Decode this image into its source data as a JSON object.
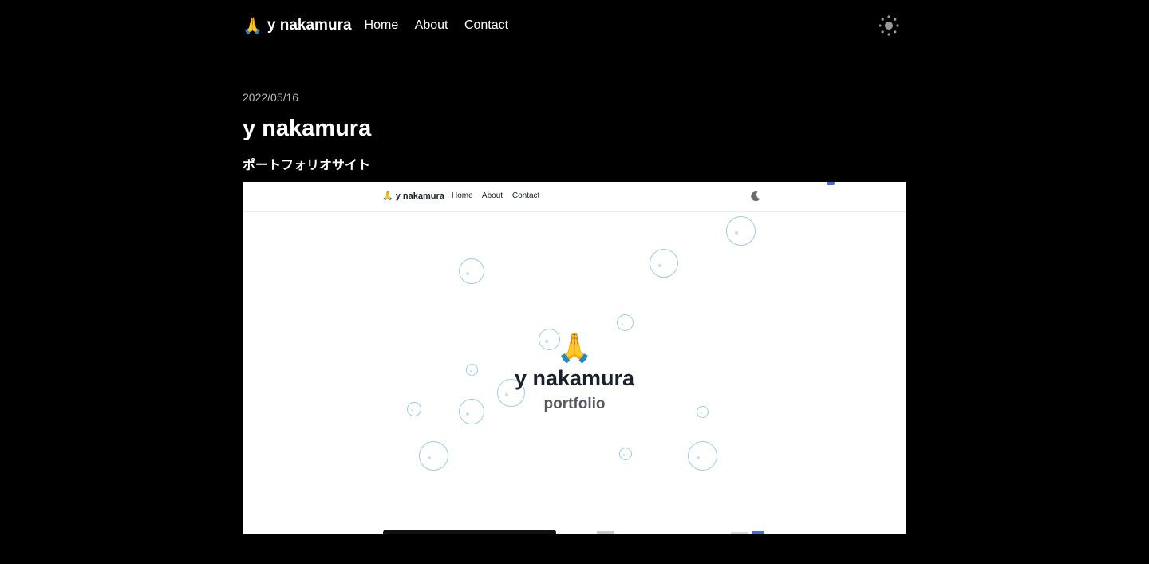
{
  "header": {
    "brand_emoji": "🙏",
    "brand_name": "y nakamura",
    "nav": [
      "Home",
      "About",
      "Contact"
    ],
    "theme_icon": "sun-icon"
  },
  "post": {
    "date": "2022/05/16",
    "title": "y nakamura",
    "subtitle": "ポートフォリオサイト"
  },
  "screenshot": {
    "brand": "🙏 y nakamura",
    "nav": [
      "Home",
      "About",
      "Contact"
    ],
    "theme_icon": "moon-icon",
    "hero_emoji": "🙏",
    "hero_title": "y nakamura",
    "hero_subtitle": "portfolio",
    "bubble_color": "#9ccbea"
  },
  "colors": {
    "background": "#000000",
    "text": "#ffffff",
    "date": "#b9b9b9"
  }
}
